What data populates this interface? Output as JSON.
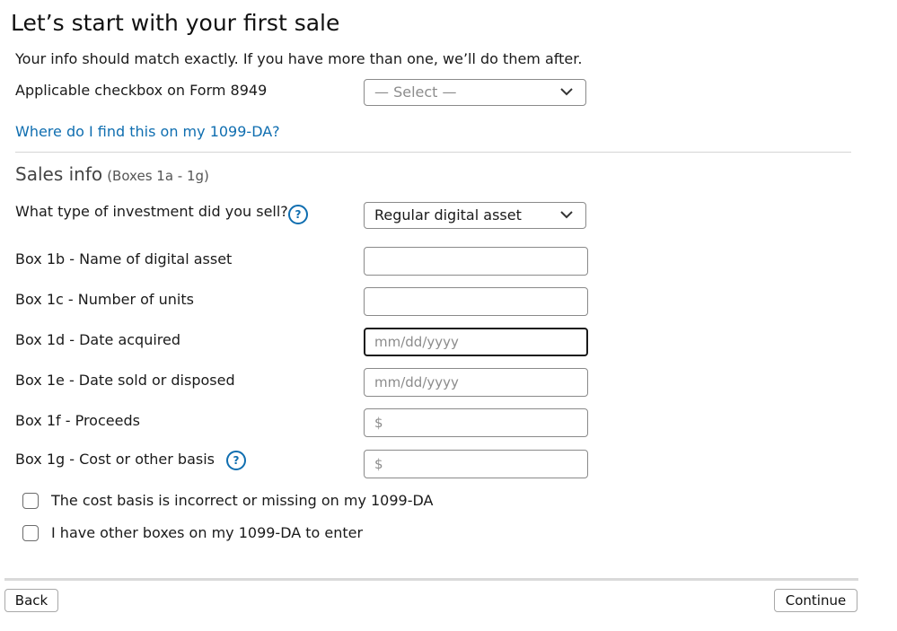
{
  "header": {
    "title": "Let’s start with your first sale",
    "subtitle": "Your info should match exactly. If you have more than one, we’ll do them after."
  },
  "form8949": {
    "label": "Applicable checkbox on Form 8949",
    "select_value": "— Select —",
    "help_link": "Where do I find this on my 1099-DA?"
  },
  "sales_info": {
    "title": "Sales info",
    "subtitle": "(Boxes 1a - 1g)"
  },
  "fields": {
    "investment_type": {
      "label": "What type of investment did you sell?",
      "value": "Regular digital asset",
      "help_glyph": "?"
    },
    "box_1b": {
      "label": "Box 1b - Name of digital asset",
      "value": "",
      "placeholder": ""
    },
    "box_1c": {
      "label": "Box 1c - Number of units",
      "value": "",
      "placeholder": ""
    },
    "box_1d": {
      "label": "Box 1d - Date acquired",
      "value": "",
      "placeholder": "mm/dd/yyyy"
    },
    "box_1e": {
      "label": "Box 1e - Date sold or disposed",
      "value": "",
      "placeholder": "mm/dd/yyyy"
    },
    "box_1f": {
      "label": "Box 1f - Proceeds",
      "value": "",
      "placeholder": "$"
    },
    "box_1g": {
      "label": "Box 1g - Cost or other basis",
      "value": "",
      "placeholder": "$",
      "help_glyph": "?"
    }
  },
  "checkboxes": [
    {
      "label": "The cost basis is incorrect or missing on my 1099-DA",
      "checked": false
    },
    {
      "label": "I have other boxes on my 1099-DA to enter",
      "checked": false
    }
  ],
  "footer": {
    "back_label": "Back",
    "continue_label": "Continue"
  },
  "colors": {
    "link": "#0f6eb0",
    "focus_border": "#1a1a1a"
  },
  "icons": {
    "dropdown": "chevron-down-icon",
    "help": "help-circle-icon"
  }
}
